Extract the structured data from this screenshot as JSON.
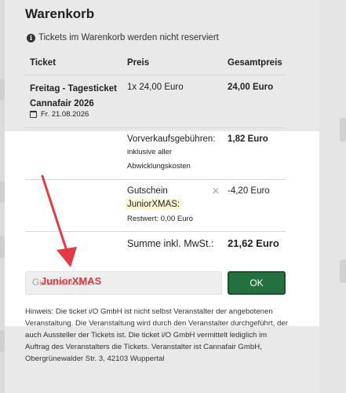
{
  "page": {
    "title": "Warenkorb",
    "notice": "Tickets im Warenkorb werden nicht reserviert"
  },
  "table": {
    "headers": {
      "ticket": "Ticket",
      "price": "Preis",
      "total": "Gesamtpreis"
    },
    "ticket": {
      "name_line1": "Freitag - Tagesticket",
      "name_line2": "Cannafair 2026",
      "date": "Fr. 21.08.2026",
      "price": "1x 24,00 Euro",
      "total": "24,00 Euro"
    },
    "fees": {
      "label": "Vorverkaufsgebühren:",
      "sublabel_1": "inklusive aller",
      "sublabel_2": "Abwicklungskosten",
      "total": "1,82 Euro"
    },
    "voucher": {
      "label": "Gutschein",
      "code": "JuniorXMAS:",
      "remaining": "Restwert: 0,00 Euro",
      "total": "-4,20 Euro",
      "remove_icon": "close-icon"
    },
    "sum": {
      "label": "Summe inkl. MwSt.:",
      "value": "21,62 Euro"
    }
  },
  "coupon_form": {
    "placeholder": "Gutscheincode",
    "typed_value": "JuniorXMAS",
    "submit_label": "OK"
  },
  "note": "Hinweis: Die ticket i/O GmbH ist nicht selbst Veranstalter der angebotenen Veranstaltung. Die Veranstaltung wird durch den Veranstalter durchgeführt, der auch Aussteller der Tickets ist. Die ticket i/O GmbH vermittelt lediglich im Auftrag des Veranstalters die Tickets. Veranstalter ist Cannafair GmbH, Obergrünewalder Str. 3, 42103 Wuppertal",
  "colors": {
    "accent_green": "#24703f",
    "annotation_red": "#e43a46",
    "highlight_yellow": "#fbf6d3"
  }
}
